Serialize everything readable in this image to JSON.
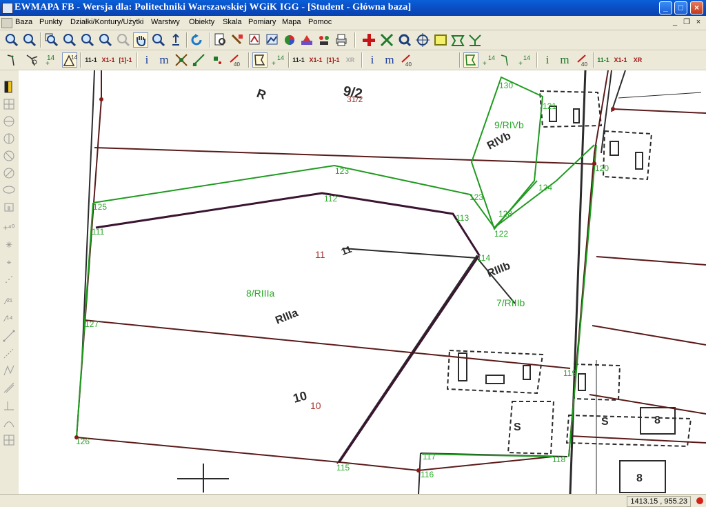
{
  "window": {
    "title": "EWMAPA FB - Wersja dla: Politechniki Warszawskiej WGiK IGG - [Student - Główna baza]"
  },
  "menu": [
    "Baza",
    "Punkty",
    "Działki/Kontury/Użytki",
    "Warstwy",
    "Obiekty",
    "Skala",
    "Pomiary",
    "Mapa",
    "Pomoc"
  ],
  "toolbar2": {
    "label_11_1": "11-1",
    "label_x11": "X1-1",
    "label_box11": "[1]-1",
    "label_xr": "XR",
    "label_i": "i",
    "label_m": "m",
    "num_14": "14",
    "num_40": "40"
  },
  "status": {
    "coordinates": "1413.15 , 955.23"
  },
  "map": {
    "point_labels": [
      "130",
      "121",
      "123",
      "9/RIVb",
      "123",
      "124",
      "125",
      "111",
      "112",
      "113",
      "114",
      "122",
      "128",
      "120",
      "127",
      "126",
      "115",
      "116",
      "117",
      "118",
      "119",
      "31/2"
    ],
    "parcel_labels": [
      "8/RIIIa",
      "7/RIIIb",
      "11",
      "10"
    ],
    "class_labels": [
      "R",
      "9/2",
      "RIVb",
      "RIIIa",
      "RIIIb",
      "11",
      "10",
      "S",
      "S",
      "8",
      "8"
    ]
  },
  "colors": {
    "parcel_line": "#5a1a1a",
    "contour_line": "#1f9a1f",
    "raster_ink": "#2b2b2b",
    "point_text": "#2aa82a",
    "parcel_text": "#a8332b"
  }
}
